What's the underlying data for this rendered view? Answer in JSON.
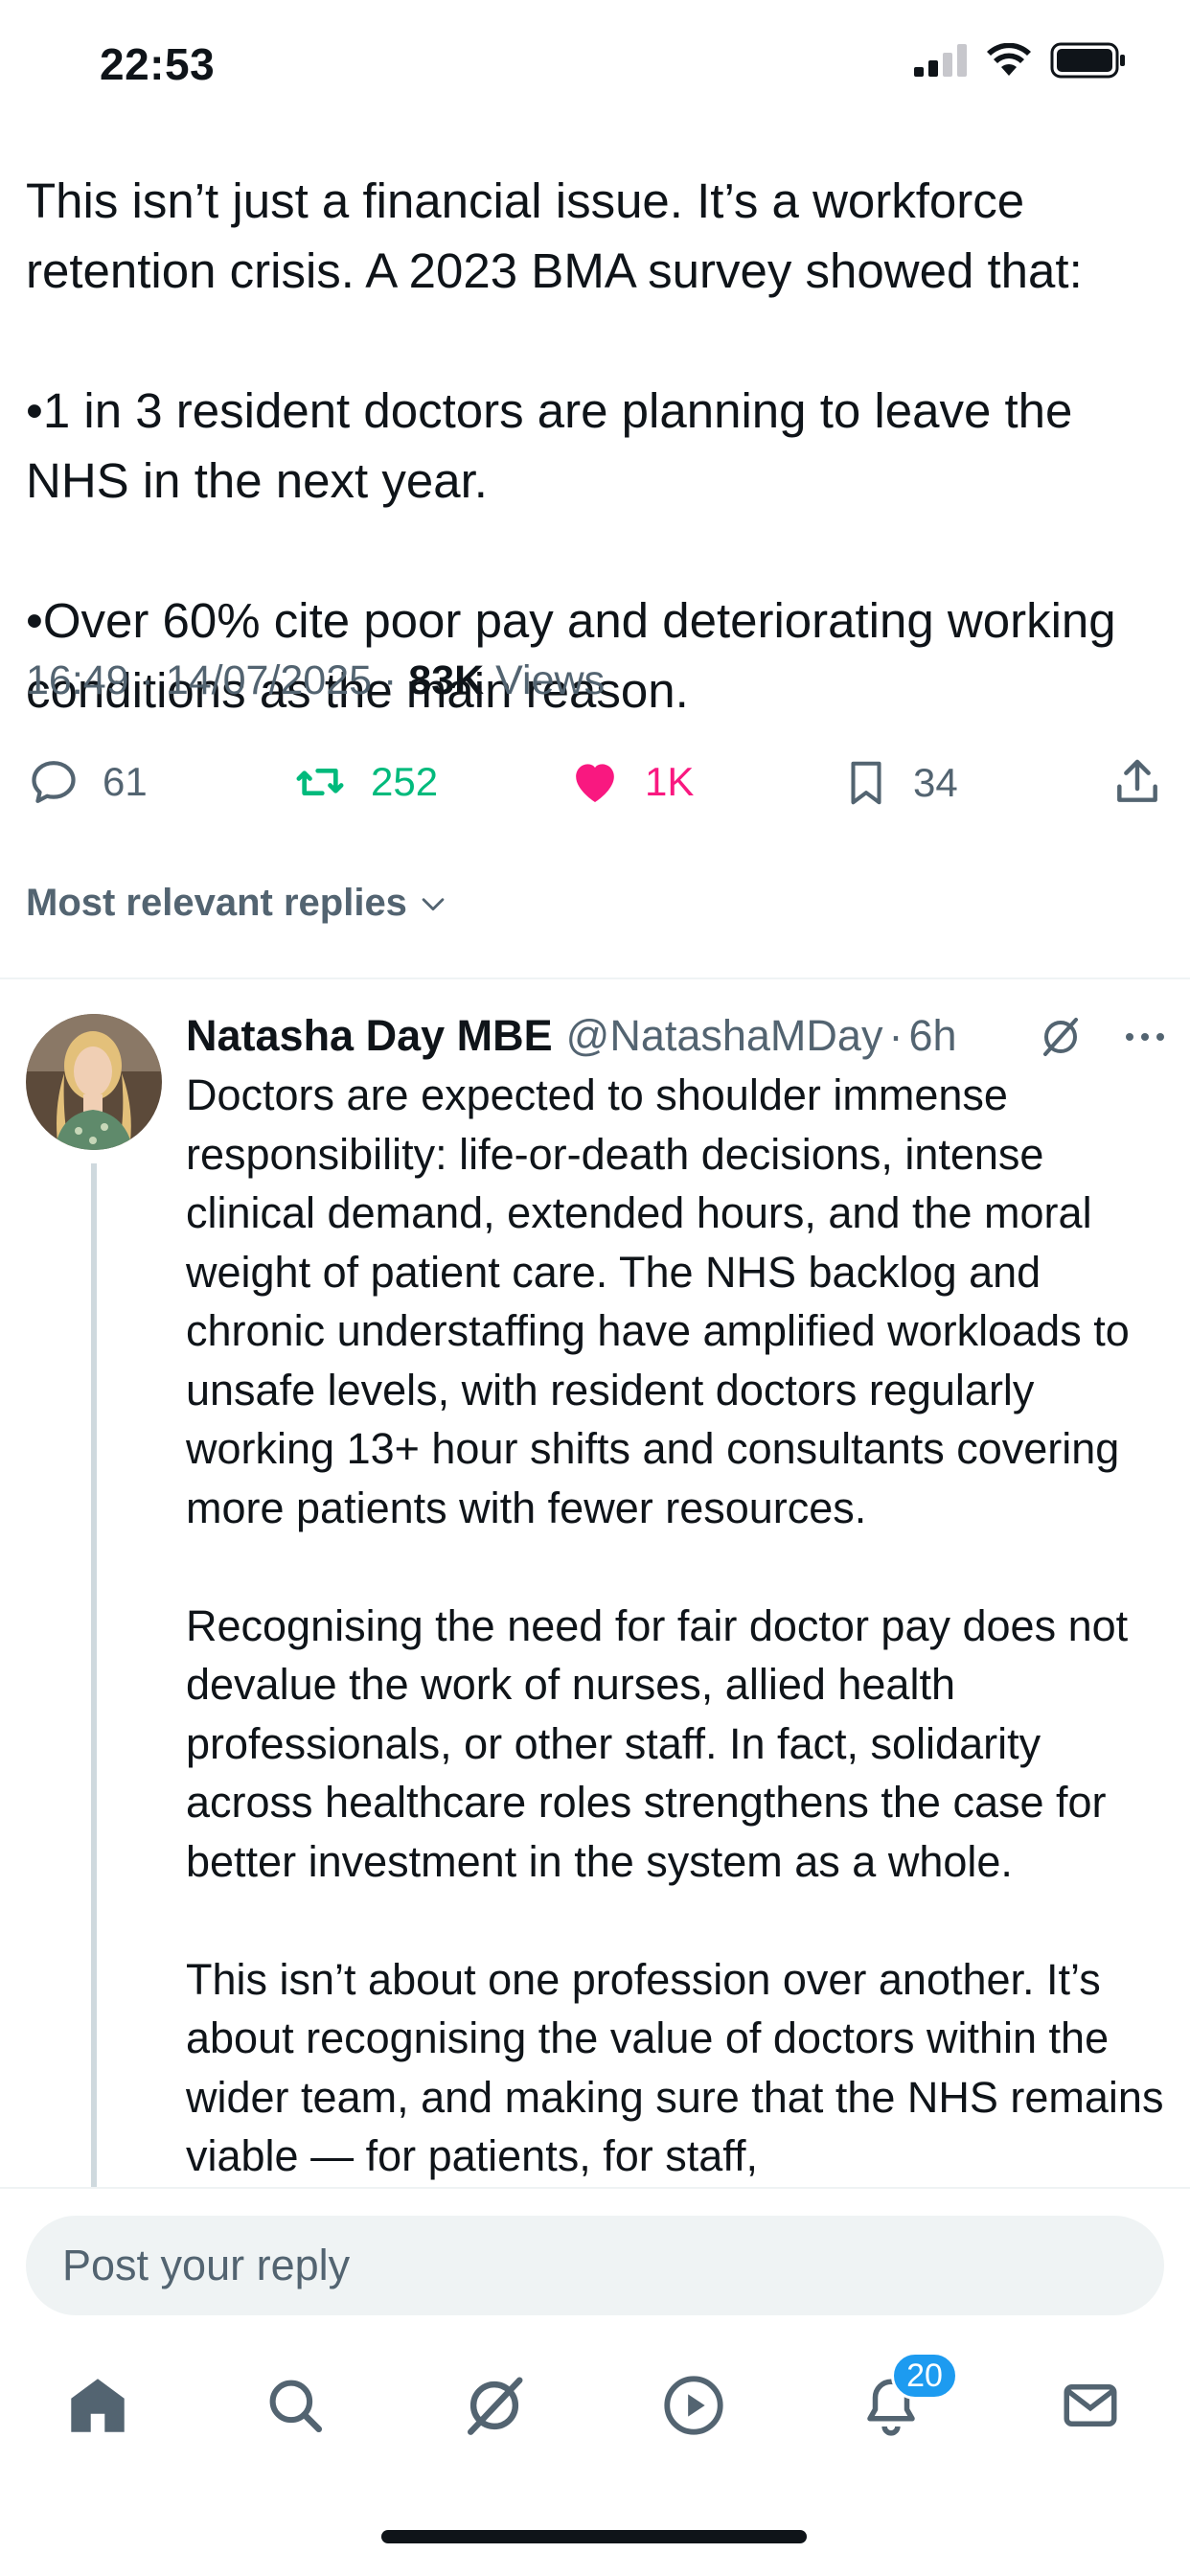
{
  "status_bar": {
    "time": "22:53",
    "icons": [
      "cellular-signal-icon",
      "wifi-icon",
      "battery-icon"
    ]
  },
  "tweet": {
    "paragraphs": [
      "This isn’t just a financial issue. It’s a workforce retention crisis. A 2023 BMA survey showed that:",
      "•1 in 3 resident doctors are planning to leave the NHS in the next year.",
      "•Over 60% cite poor pay and deteriorating working conditions as the main reason."
    ],
    "time": "16:49",
    "date": "14/07/2025",
    "views_count": "83K",
    "views_label": "Views",
    "replies": "61",
    "reposts": "252",
    "likes": "1K",
    "bookmarks": "34"
  },
  "replies_filter": {
    "label": "Most relevant replies"
  },
  "reply": {
    "name": "Natasha Day MBE",
    "handle": "@NatashaMDay",
    "age": "6h",
    "paragraphs": [
      "Doctors are expected to shoulder immense responsibility: life-or-death decisions, intense clinical demand, extended hours, and the moral weight of patient care. The NHS backlog and chronic understaffing have amplified workloads to unsafe levels, with resident doctors regularly working 13+ hour shifts and consultants covering more patients with fewer resources.",
      "Recognising the need for fair doctor pay does not devalue the work of nurses, allied health professionals, or other staff. In fact, solidarity across healthcare roles strengthens the case for better investment in the system as a whole.",
      "This isn’t about one profession over another. It’s about recognising the value of doctors within the wider team, and making sure that the NHS remains viable — for patients, for staff,"
    ]
  },
  "composer": {
    "placeholder": "Post your reply"
  },
  "tabbar": {
    "items": [
      "home-icon",
      "search-icon",
      "grok-icon",
      "video-icon",
      "notifications-icon",
      "messages-icon"
    ],
    "notifications_badge": "20"
  },
  "colors": {
    "text": "#0f1419",
    "secondary": "#536471",
    "repost": "#00ba7c",
    "like": "#f91880",
    "accent": "#1d9bf0"
  }
}
